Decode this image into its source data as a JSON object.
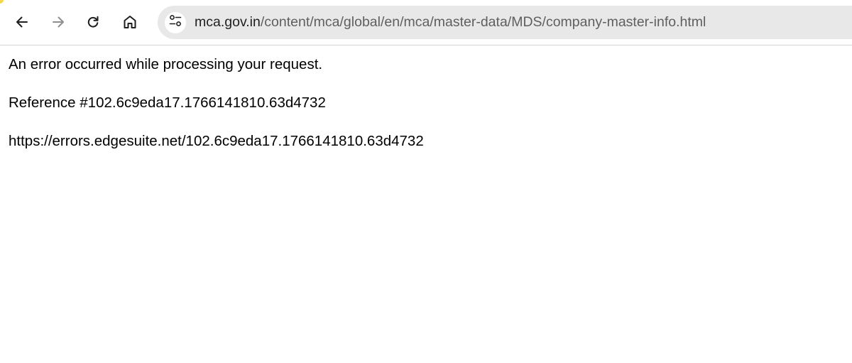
{
  "browser": {
    "url_host": "mca.gov.in",
    "url_path": "/content/mca/global/en/mca/master-data/MDS/company-master-info.html",
    "nav_icons": [
      "back-arrow-icon",
      "forward-arrow-icon",
      "reload-icon",
      "home-icon",
      "tune-icon"
    ],
    "colors": {
      "omnibox_bg": "#e8e8e8",
      "url_host": "#1f1f1f",
      "url_path": "#5f5f5f",
      "accent": "#f4d64a"
    }
  },
  "page": {
    "error_message": "An error occurred while processing your request.",
    "reference": "Reference #102.6c9eda17.1766141810.63d4732",
    "error_url": "https://errors.edgesuite.net/102.6c9eda17.1766141810.63d4732"
  }
}
